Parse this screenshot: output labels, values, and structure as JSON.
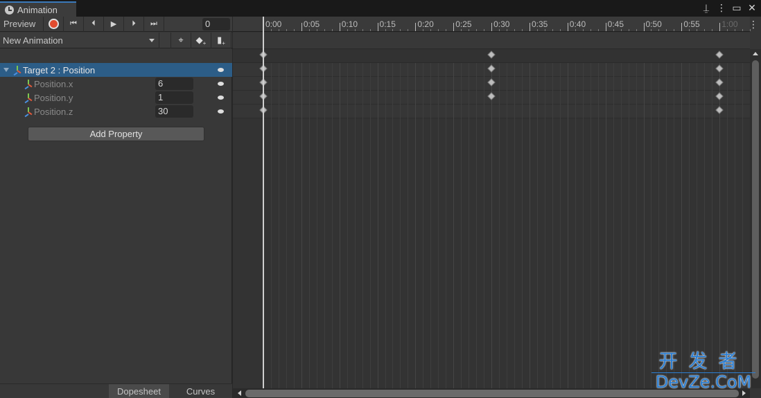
{
  "window": {
    "tab_title": "Animation",
    "tab_icon": "clock-icon",
    "controls": [
      "lock-icon",
      "kebab-menu-icon",
      "maximize-icon",
      "close-icon"
    ],
    "control_glyphs": {
      "lock": "⍊",
      "menu": "⋮",
      "maximize": "▭",
      "close": "✕"
    }
  },
  "toolbar": {
    "preview_label": "Preview",
    "record_icon": "record-icon",
    "first_key_glyph": "⏮",
    "prev_key_glyph": "⏴",
    "play_glyph": "▶",
    "next_key_glyph": "⏵",
    "last_key_glyph": "⏭",
    "frame_value": "0",
    "clip_name": "New Animation",
    "add_keyframe_glyph": "◆",
    "add_event_glyph": "▮",
    "filter_glyph": "⌖"
  },
  "colors": {
    "accent": "#3a79bb",
    "selection": "#2c5d87",
    "record": "#e24c2f",
    "watermark": "#2c7fd3"
  },
  "properties": {
    "group": {
      "label": "Target 2 : Position",
      "expanded": true
    },
    "items": [
      {
        "label": "Position.x",
        "value": "6"
      },
      {
        "label": "Position.y",
        "value": "1"
      },
      {
        "label": "Position.z",
        "value": "30"
      }
    ],
    "add_property_label": "Add Property"
  },
  "bottom_tabs": {
    "dopesheet": "Dopesheet",
    "curves": "Curves",
    "active": "Dopesheet"
  },
  "timeline": {
    "ticks": [
      "0:00",
      "0:05",
      "0:10",
      "0:15",
      "0:20",
      "0:25",
      "0:30",
      "0:35",
      "0:40",
      "0:45",
      "0:50",
      "0:55",
      "1:00"
    ],
    "clip_end_seconds": 60,
    "playhead_seconds": 0,
    "keyframes": {
      "summary": [
        0,
        30,
        60
      ],
      "Target 2 : Position": [
        0,
        30,
        60
      ],
      "Position.x": [
        0,
        30,
        60
      ],
      "Position.y": [
        0,
        30,
        60
      ],
      "Position.z": [
        0,
        60
      ]
    }
  },
  "watermark": {
    "cn": "开发者",
    "en": "DevZe.CoM"
  }
}
